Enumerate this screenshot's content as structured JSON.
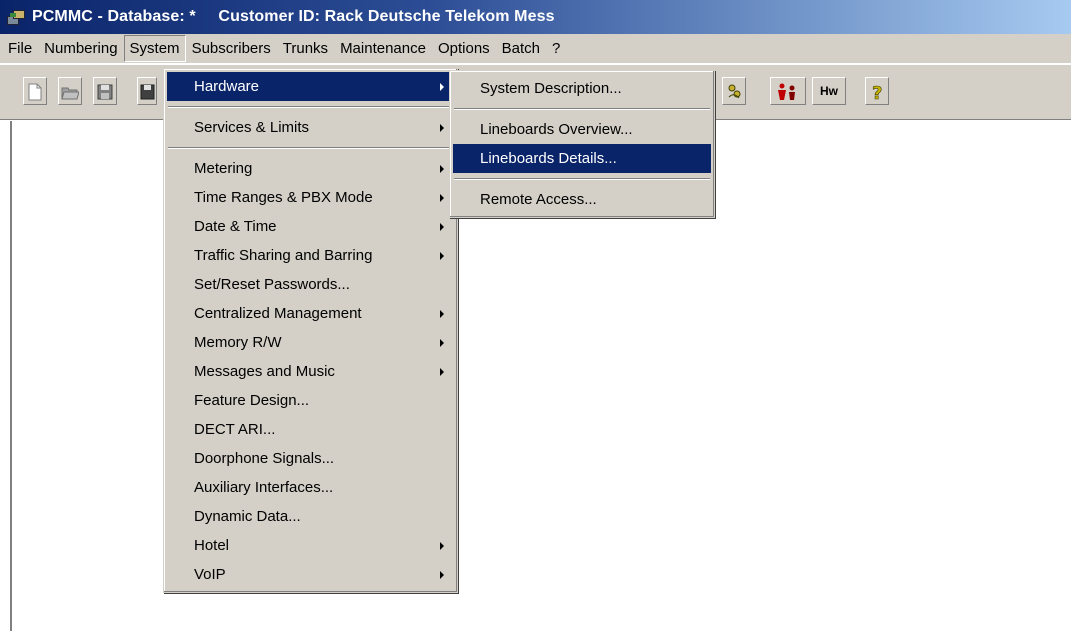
{
  "window": {
    "title": "PCMMC - Database: *     Customer ID: Rack Deutsche Telekom Mess"
  },
  "menubar": {
    "items": [
      "File",
      "Numbering",
      "System",
      "Subscribers",
      "Trunks",
      "Maintenance",
      "Options",
      "Batch",
      "?"
    ],
    "open_item": "System"
  },
  "toolbar": {
    "buttons": [
      {
        "icon": "new-document-icon"
      },
      {
        "icon": "open-folder-icon"
      },
      {
        "icon": "save-icon"
      },
      {
        "icon": "save-as-icon"
      },
      {
        "icon": "network-icon"
      },
      {
        "icon": "subscriber-icon"
      },
      {
        "icon": "hardware-icon",
        "label": "Hw"
      },
      {
        "icon": "help-icon"
      }
    ]
  },
  "system_menu": {
    "items": [
      {
        "label": "Hardware",
        "submenu": true,
        "highlighted": true
      },
      {
        "label": "Services & Limits",
        "submenu": true
      },
      {
        "label": "Metering",
        "submenu": true
      },
      {
        "label": "Time Ranges & PBX Mode",
        "submenu": true
      },
      {
        "label": "Date & Time",
        "submenu": true
      },
      {
        "label": "Traffic Sharing and Barring",
        "submenu": true
      },
      {
        "label": "Set/Reset Passwords...",
        "submenu": false
      },
      {
        "label": "Centralized Management",
        "submenu": true
      },
      {
        "label": "Memory R/W",
        "submenu": true
      },
      {
        "label": "Messages and Music",
        "submenu": true
      },
      {
        "label": "Feature Design...",
        "submenu": false
      },
      {
        "label": "DECT ARI...",
        "submenu": false
      },
      {
        "label": "Doorphone Signals...",
        "submenu": false
      },
      {
        "label": "Auxiliary Interfaces...",
        "submenu": false
      },
      {
        "label": "Dynamic Data...",
        "submenu": false
      },
      {
        "label": "Hotel",
        "submenu": true
      },
      {
        "label": "VoIP",
        "submenu": true
      }
    ]
  },
  "hardware_menu": {
    "items": [
      {
        "label": "System Description..."
      },
      {
        "label": "Lineboards Overview..."
      },
      {
        "label": "Lineboards Details...",
        "highlighted": true
      },
      {
        "label": "Remote Access..."
      }
    ]
  },
  "colors": {
    "menu_bg": "#d4d0c8",
    "highlight": "#0a246a",
    "title_start": "#0a246a",
    "title_end": "#a6caf0"
  }
}
